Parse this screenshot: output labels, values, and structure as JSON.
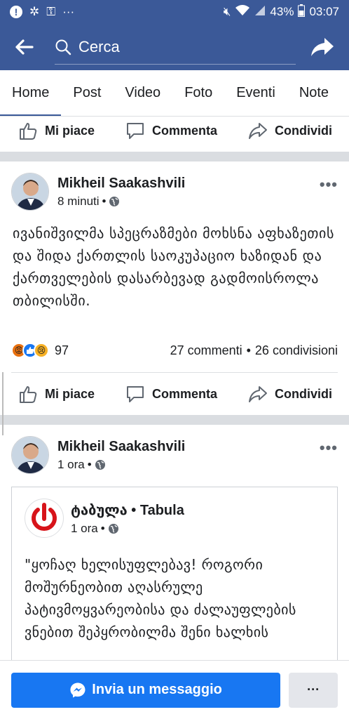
{
  "status_bar": {
    "time": "03:07",
    "battery": "43%"
  },
  "header": {
    "search_placeholder": "Cerca"
  },
  "tabs": [
    {
      "label": "Home"
    },
    {
      "label": "Post"
    },
    {
      "label": "Video"
    },
    {
      "label": "Foto"
    },
    {
      "label": "Eventi"
    },
    {
      "label": "Note"
    }
  ],
  "actions": {
    "like": "Mi piace",
    "comment": "Commenta",
    "share": "Condividi"
  },
  "posts": [
    {
      "author": "Mikheil Saakashvili",
      "time": "8 minuti",
      "text": "ივანიშვილმა სპეცრაზმები მოხსნა აფხაზეთის და შიდა ქართლის საოკუპაციო ხაზიდან და ქართველების დასარბევად გადმოისროლა თბილისში.",
      "reactions_count": "97",
      "comments": "27 commenti",
      "shares": "26 condivisioni"
    },
    {
      "author": "Mikheil Saakashvili",
      "time": "1 ora",
      "shared": {
        "page": "ტაბულა • Tabula",
        "time": "1 ora",
        "text": "\"ყოჩაღ ხელისუფლებავ! როგორი მოშურნეობით აღასრულე პატივმოყვარეობისა და ძალაუფლების ვნებით შეპყრობილმა შენი ხალხის"
      }
    }
  ],
  "bottom_bar": {
    "message_button": "Invia un messaggio",
    "more_button": "···"
  },
  "colors": {
    "brand": "#3b5998",
    "messenger_button": "#1877f2"
  }
}
